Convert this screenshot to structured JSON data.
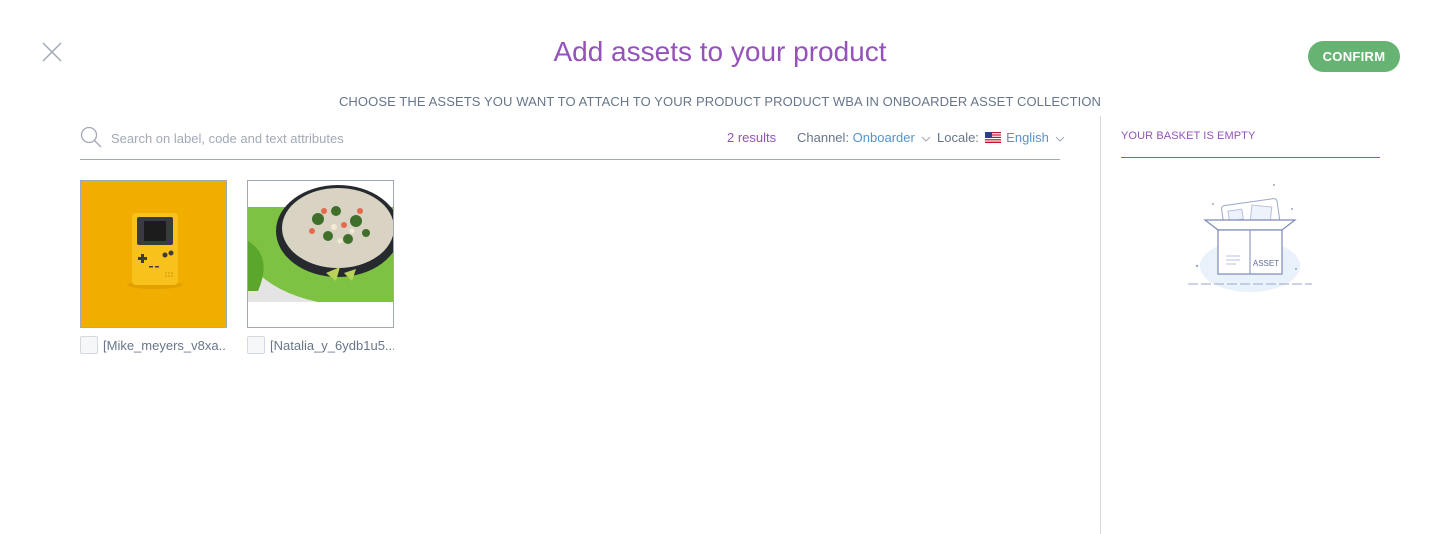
{
  "header": {
    "title": "Add assets to your product",
    "confirm_label": "CONFIRM",
    "subtitle": "CHOOSE THE ASSETS YOU WANT TO ATTACH TO YOUR PRODUCT PRODUCT WBA IN ONBOARDER ASSET COLLECTION"
  },
  "search": {
    "placeholder": "Search on label, code and text attributes",
    "value": "",
    "results": "2 results",
    "channel_label": "Channel:",
    "channel_value": "Onboarder",
    "locale_label": "Locale:",
    "locale_value": "English"
  },
  "assets": [
    {
      "label": "[Mike_meyers_v8xa...",
      "checked": false,
      "thumb": "yellow-gameboy"
    },
    {
      "label": "[Natalia_y_6ydb1u5...",
      "checked": false,
      "thumb": "salad-bowl"
    }
  ],
  "basket": {
    "title": "YOUR BASKET IS EMPTY",
    "illustration_label": "ASSET"
  },
  "icons": {
    "close": "close-icon",
    "search": "search-icon",
    "caret": "chevron-down-icon",
    "flag": "us-flag-icon"
  },
  "colors": {
    "accent": "#9452ba",
    "confirm": "#67b373",
    "link": "#5992c7",
    "text": "#67768a"
  }
}
